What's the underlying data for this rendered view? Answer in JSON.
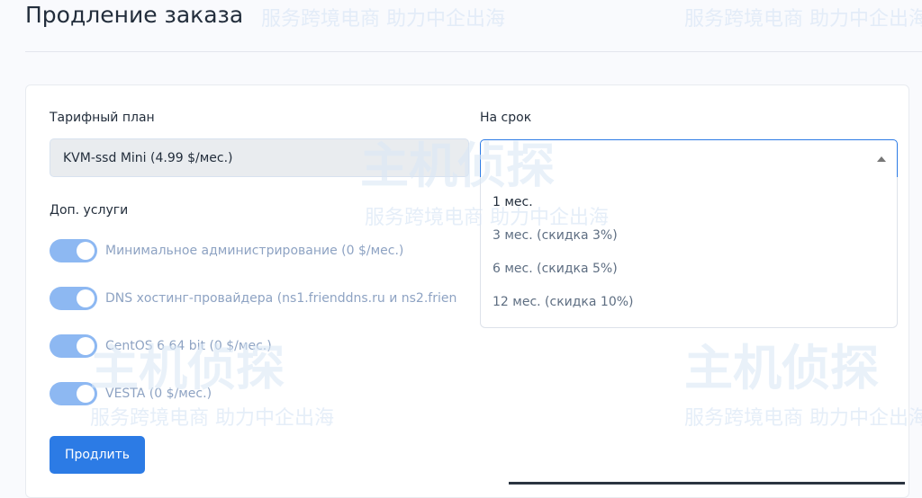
{
  "page": {
    "title": "Продление заказа"
  },
  "form": {
    "plan_label": "Тарифный план",
    "plan_value": "KVM-ssd Mini (4.99 $/мес.)",
    "term_label": "На срок",
    "term_options": [
      "1 мес.",
      "3 мес. (скидка 3%)",
      "6 мес. (скидка 5%)",
      "12 мес. (скидка 10%)"
    ],
    "services_label": "Доп. услуги",
    "services": [
      {
        "label": "Минимальное администрирование (0 $/мес.)",
        "checked": true
      },
      {
        "label": "DNS хостинг-провайдера (ns1.friendd­ns.ru и ns2.frien",
        "checked": true
      },
      {
        "label": "CentOS 6 64 bit (0 $/мес.)",
        "checked": true
      },
      {
        "label": "VESTA (0 $/мес.)",
        "checked": true
      }
    ],
    "submit_label": "Продлить"
  },
  "watermark": {
    "brand": "主机侦探",
    "slogan": "服务跨境电商 助力中企出海"
  },
  "colors": {
    "primary": "#2c7be5",
    "toggle": "#8db8f2"
  }
}
